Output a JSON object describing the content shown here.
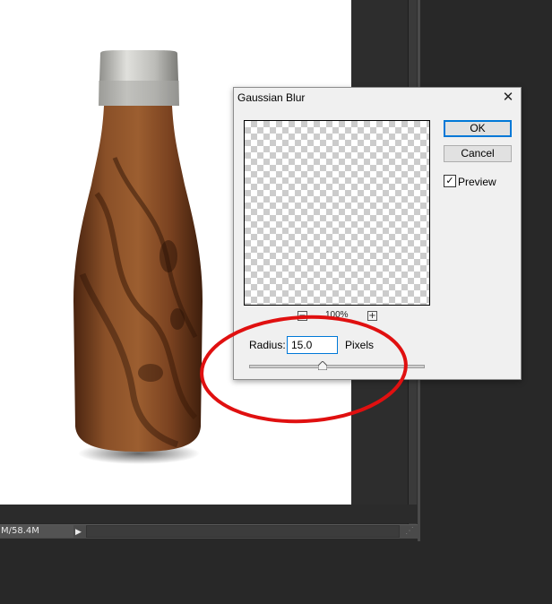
{
  "status": {
    "doc_size": "M/58.4M",
    "arrow": "▶"
  },
  "dialog": {
    "title": "Gaussian Blur",
    "close_glyph": "✕",
    "ok_label": "OK",
    "cancel_label": "Cancel",
    "preview_label": "Preview",
    "preview_checked": "✓",
    "zoom_label": "100%",
    "zoom_minus": "−",
    "zoom_plus": "+",
    "radius_label": "Radius:",
    "radius_value": "15.0",
    "radius_unit": "Pixels",
    "radius_slider_fraction": 0.42
  },
  "colors": {
    "annotation": "#e01010",
    "ok_focus": "#0078d7",
    "bottle_wood": "#7a4520",
    "bottle_cap": "#b8b8b4"
  },
  "icons": {
    "close": "close-icon",
    "check": "checkmark-icon",
    "zoom_out": "zoom-out-icon",
    "zoom_in": "zoom-in-icon",
    "status_menu": "triangle-right-icon"
  }
}
